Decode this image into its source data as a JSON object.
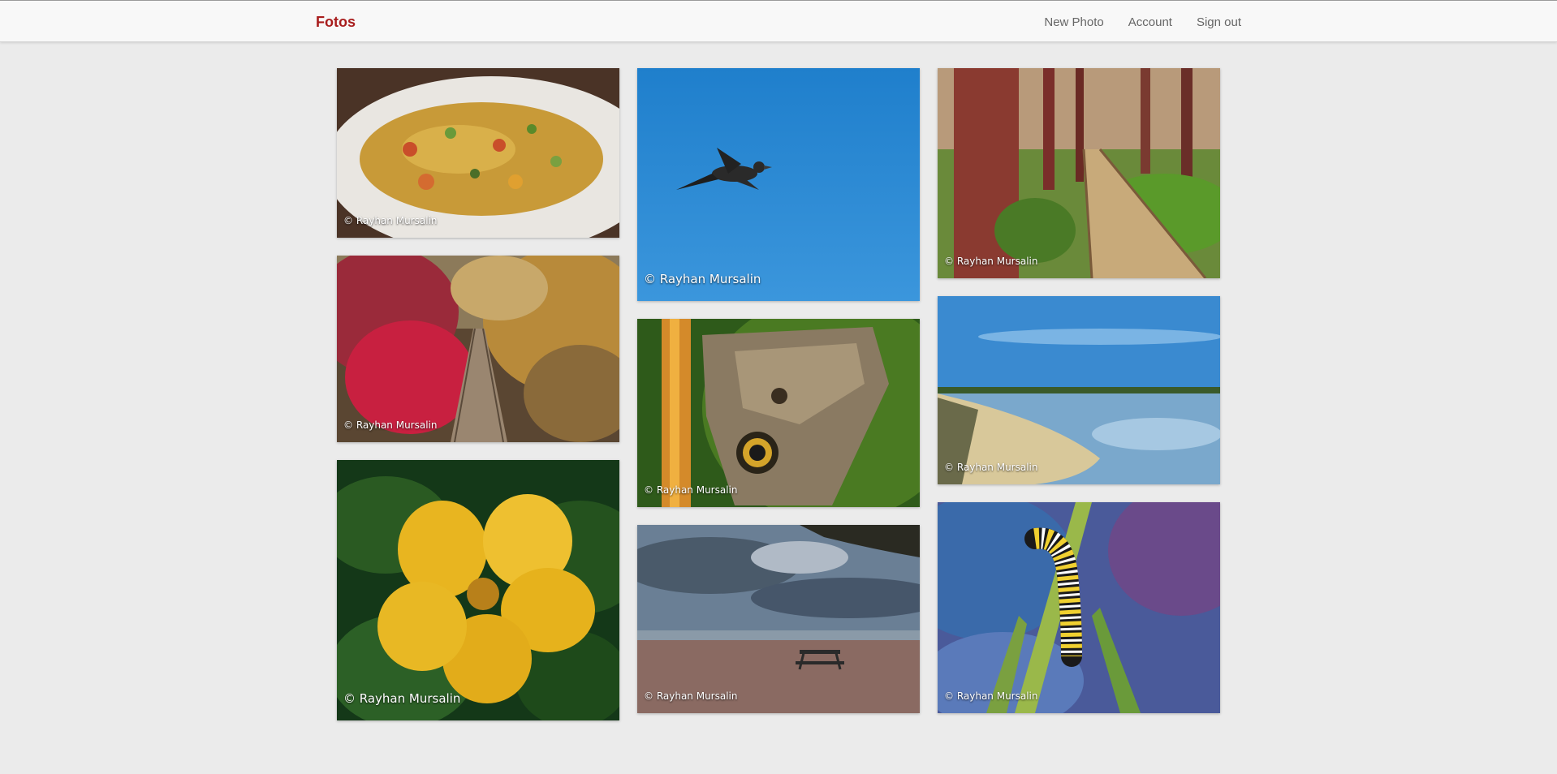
{
  "navbar": {
    "brand": "Fotos",
    "links": [
      "New Photo",
      "Account",
      "Sign out"
    ]
  },
  "photos": [
    {
      "subject": "omelette-on-plate",
      "credit": "© Rayhan Mursalin"
    },
    {
      "subject": "autumn-suspension-bridge",
      "credit": "© Rayhan Mursalin"
    },
    {
      "subject": "yellow-flower-with-raindrops",
      "credit": "© Rayhan Mursalin"
    },
    {
      "subject": "bird-in-blue-sky",
      "credit": "© Rayhan Mursalin"
    },
    {
      "subject": "owl-butterfly-on-stem",
      "credit": "© Rayhan Mursalin"
    },
    {
      "subject": "beach-picnic-table-clouds",
      "credit": "© Rayhan Mursalin"
    },
    {
      "subject": "forest-boardwalk",
      "credit": "© Rayhan Mursalin"
    },
    {
      "subject": "tidal-beach-blue-sky",
      "credit": "© Rayhan Mursalin"
    },
    {
      "subject": "monarch-caterpillar-on-milkweed",
      "credit": "© Rayhan Mursalin"
    }
  ]
}
